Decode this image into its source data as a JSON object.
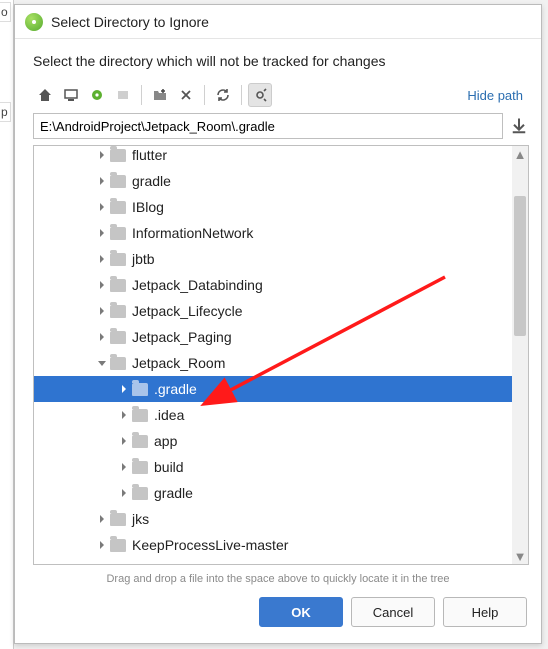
{
  "dialog": {
    "title": "Select Directory to Ignore",
    "instruction": "Select the directory which will not be tracked for changes",
    "hide_path": "Hide path",
    "path_value": "E:\\AndroidProject\\Jetpack_Room\\.gradle",
    "hint": "Drag and drop a file into the space above to quickly locate it in the tree"
  },
  "buttons": {
    "ok": "OK",
    "cancel": "Cancel",
    "help": "Help"
  },
  "tree": {
    "items": [
      {
        "indent": 60,
        "expander": "right",
        "label": "flutter",
        "cut": true
      },
      {
        "indent": 60,
        "expander": "right",
        "label": "gradle"
      },
      {
        "indent": 60,
        "expander": "right",
        "label": "IBlog"
      },
      {
        "indent": 60,
        "expander": "right",
        "label": "InformationNetwork"
      },
      {
        "indent": 60,
        "expander": "right",
        "label": "jbtb"
      },
      {
        "indent": 60,
        "expander": "right",
        "label": "Jetpack_Databinding"
      },
      {
        "indent": 60,
        "expander": "right",
        "label": "Jetpack_Lifecycle"
      },
      {
        "indent": 60,
        "expander": "right",
        "label": "Jetpack_Paging"
      },
      {
        "indent": 60,
        "expander": "down",
        "label": "Jetpack_Room"
      },
      {
        "indent": 82,
        "expander": "right",
        "label": ".gradle",
        "selected": true
      },
      {
        "indent": 82,
        "expander": "right",
        "label": ".idea"
      },
      {
        "indent": 82,
        "expander": "right",
        "label": "app"
      },
      {
        "indent": 82,
        "expander": "right",
        "label": "build"
      },
      {
        "indent": 82,
        "expander": "right",
        "label": "gradle"
      },
      {
        "indent": 60,
        "expander": "right",
        "label": "jks"
      },
      {
        "indent": 60,
        "expander": "right",
        "label": "KeepProcessLive-master"
      }
    ]
  }
}
